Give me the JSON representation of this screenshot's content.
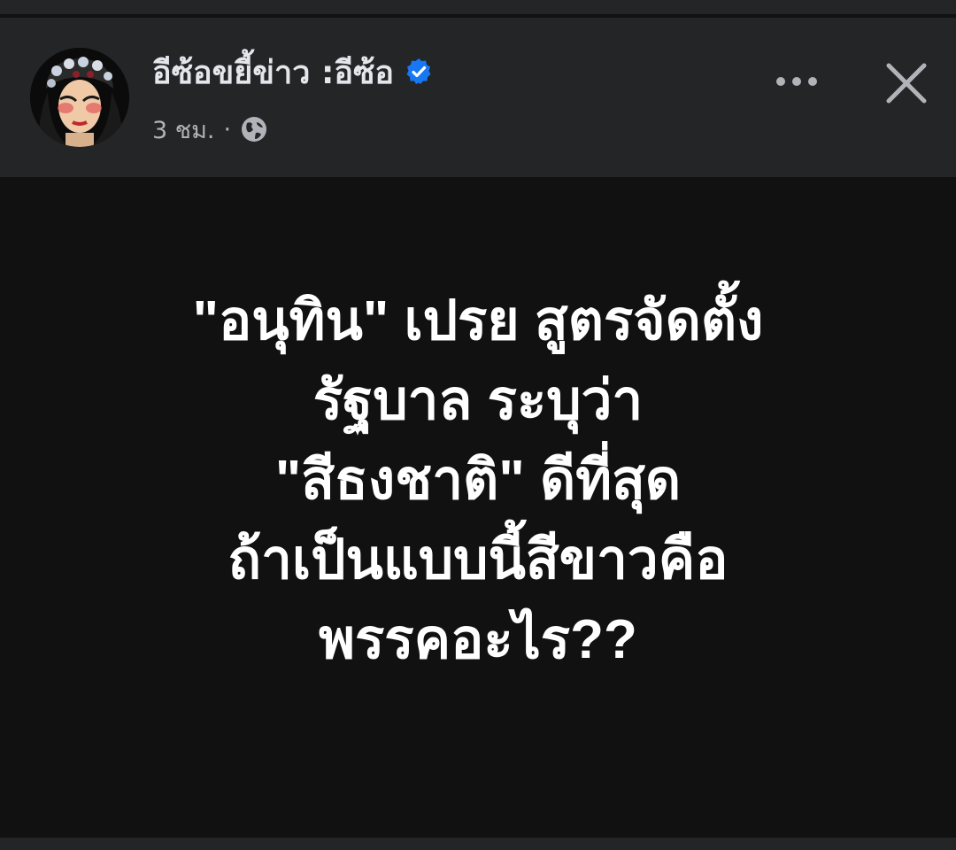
{
  "post": {
    "author_name": "อีซ้อขยี้ข่าว :อีซ้อ",
    "verified_icon": "verified-badge-icon",
    "time_ago": "3 ชม.",
    "separator": "·",
    "audience_icon": "globe-icon",
    "text_lines": [
      "\"อนุทิน\" เปรย สูตรจัดตั้ง",
      "รัฐบาล ระบุว่า",
      "\"สีธงชาติ\" ดีที่สุด",
      "ถ้าเป็นแบบนี้สีขาวคือ",
      "พรรคอะไร??"
    ]
  },
  "actions": {
    "more_icon": "more-horizontal-icon",
    "close_icon": "close-icon"
  },
  "colors": {
    "header_bg": "#242526",
    "body_bg": "#111111",
    "name_text": "#e4e6eb",
    "meta_text": "#b0b3b8",
    "verified_blue": "#1877f2",
    "post_text": "#ffffff"
  }
}
